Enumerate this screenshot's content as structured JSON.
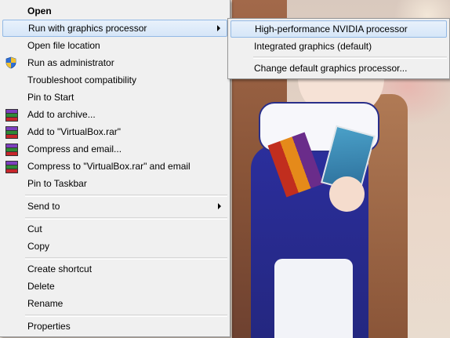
{
  "main_menu": {
    "items": [
      {
        "label": "Open"
      },
      {
        "label": "Run with graphics processor"
      },
      {
        "label": "Open file location"
      },
      {
        "label": "Run as administrator"
      },
      {
        "label": "Troubleshoot compatibility"
      },
      {
        "label": "Pin to Start"
      },
      {
        "label": "Add to archive..."
      },
      {
        "label": "Add to \"VirtualBox.rar\""
      },
      {
        "label": "Compress and email..."
      },
      {
        "label": "Compress to \"VirtualBox.rar\" and email"
      },
      {
        "label": "Pin to Taskbar"
      },
      {
        "label": "Send to"
      },
      {
        "label": "Cut"
      },
      {
        "label": "Copy"
      },
      {
        "label": "Create shortcut"
      },
      {
        "label": "Delete"
      },
      {
        "label": "Rename"
      },
      {
        "label": "Properties"
      }
    ]
  },
  "sub_menu": {
    "items": [
      {
        "label": "High-performance NVIDIA processor"
      },
      {
        "label": "Integrated graphics (default)"
      },
      {
        "label": "Change default graphics processor..."
      }
    ]
  },
  "icons": {
    "run_as_admin": "uac-shield-icon",
    "archive": "winrar-icon"
  },
  "colors": {
    "menu_background": "#f0f0f0",
    "highlight_background": "#d6e6f8",
    "highlight_border": "#93b9e5"
  }
}
